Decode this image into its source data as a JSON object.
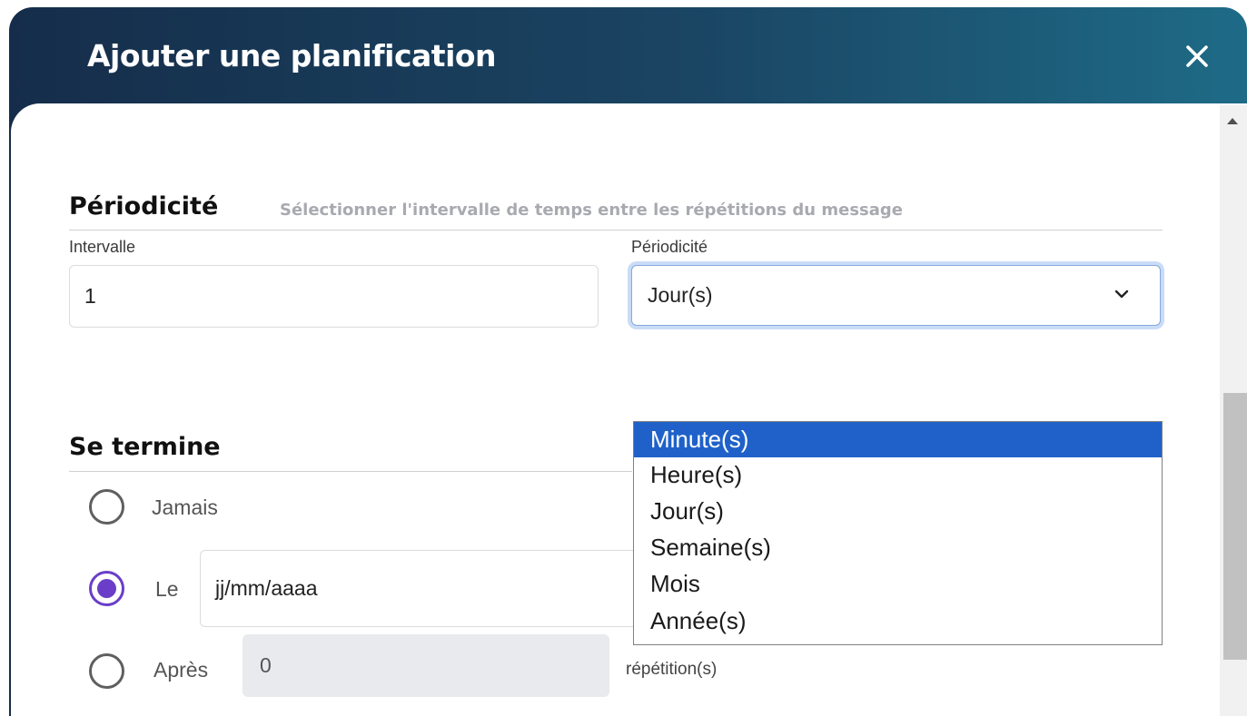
{
  "dialog": {
    "title": "Ajouter une planification"
  },
  "periodicity_section": {
    "title": "Périodicité",
    "subtitle": "Sélectionner l'intervalle de temps entre les répétitions du message",
    "interval_label": "Intervalle",
    "interval_value": "1",
    "period_label": "Périodicité",
    "period_value": "Jour(s)",
    "options": [
      "Minute(s)",
      "Heure(s)",
      "Jour(s)",
      "Semaine(s)",
      "Mois",
      "Année(s)"
    ],
    "highlighted_option": "Minute(s)"
  },
  "ends_section": {
    "title": "Se termine",
    "never_label": "Jamais",
    "on_label": "Le",
    "date_placeholder": "jj/mm/aaaa",
    "after_label": "Après",
    "after_value": "0",
    "repetitions_suffix": "répétition(s)",
    "selected": "Le"
  },
  "colors": {
    "header_start": "#152d4a",
    "header_end": "#1e6b87",
    "accent_radio": "#6a3ec8",
    "option_highlight": "#1f61c9",
    "focus_ring": "#c9dcf7"
  },
  "icons": {
    "close": "close-icon",
    "chevron": "chevron-down-icon",
    "calendar": "calendar-icon"
  }
}
